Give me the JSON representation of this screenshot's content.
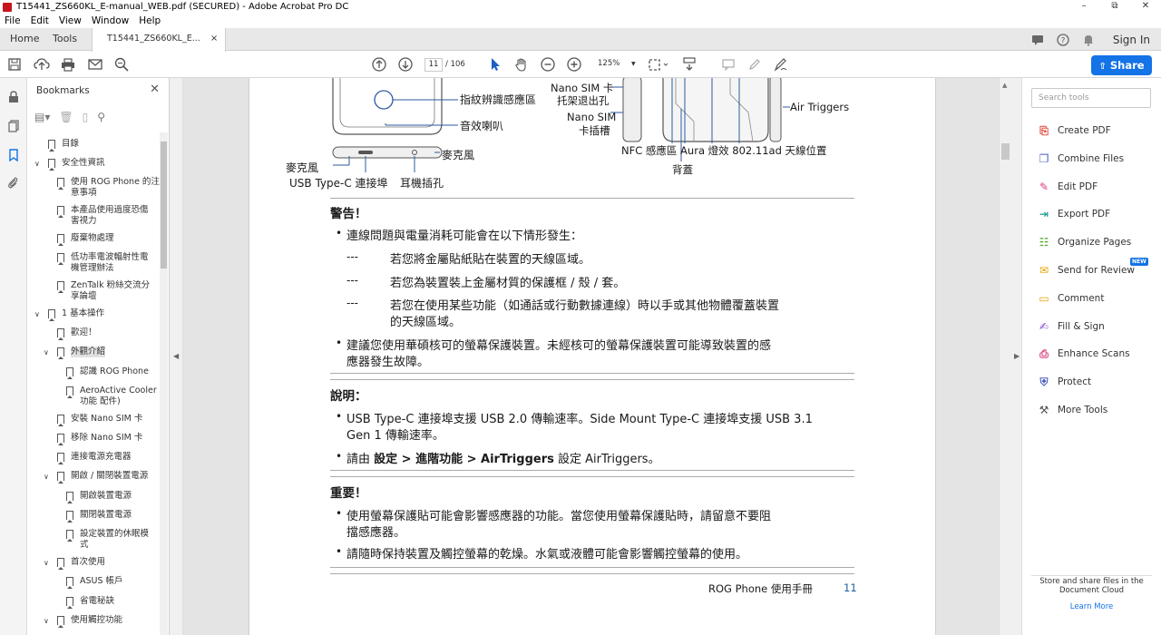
{
  "window": {
    "title": "T15441_ZS660KL_E-manual_WEB.pdf (SECURED) - Adobe Acrobat Pro DC",
    "controls": [
      "–",
      "⧉",
      "✕"
    ]
  },
  "menu": [
    "File",
    "Edit",
    "View",
    "Window",
    "Help"
  ],
  "tabs": {
    "home": "Home",
    "tools": "Tools",
    "doc": "T15441_ZS660KL_E...",
    "close": "×"
  },
  "account": {
    "signin": "Sign In"
  },
  "toolbar": {
    "page_current": "11",
    "page_total": "/ 106",
    "zoom": "125%",
    "share": "Share"
  },
  "bookmarks": {
    "header": "Bookmarks",
    "items": [
      {
        "label": "目錄",
        "level": 0,
        "twisty": ""
      },
      {
        "label": "安全性資訊",
        "level": 0,
        "twisty": "v"
      },
      {
        "label": "使用 ROG Phone 的注",
        "label2": "意事項",
        "level": 1,
        "twisty": ""
      },
      {
        "label": "本產品使用過度恐傷",
        "label2": "害視力",
        "level": 1,
        "twisty": ""
      },
      {
        "label": "廢棄物處理",
        "level": 1,
        "twisty": ""
      },
      {
        "label": "低功率電波輻射性電",
        "label2": "機管理辦法",
        "level": 1,
        "twisty": ""
      },
      {
        "label": "ZenTalk 粉絲交流分",
        "label2": "享論壇",
        "level": 1,
        "twisty": ""
      },
      {
        "label": "1 基本操作",
        "level": 0,
        "twisty": "v"
      },
      {
        "label": "歡迎！",
        "level": 1,
        "twisty": ""
      },
      {
        "label": "外觀介紹",
        "level": 1,
        "twisty": "v",
        "selected": true
      },
      {
        "label": "認識 ROG Phone",
        "level": 2,
        "twisty": ""
      },
      {
        "label": "AeroActive Cooler",
        "label2": "功能  配件)",
        "level": 2,
        "twisty": ""
      },
      {
        "label": "安裝 Nano SIM 卡",
        "level": 1,
        "twisty": ""
      },
      {
        "label": "移除 Nano SIM 卡",
        "level": 1,
        "twisty": ""
      },
      {
        "label": "連接電源充電器",
        "level": 1,
        "twisty": ""
      },
      {
        "label": "開啟 / 關閉裝置電源",
        "level": 1,
        "twisty": "v"
      },
      {
        "label": "開啟裝置電源",
        "level": 2,
        "twisty": ""
      },
      {
        "label": "關閉裝置電源",
        "level": 2,
        "twisty": ""
      },
      {
        "label": "設定裝置的休眠模",
        "label2": "式",
        "level": 2,
        "twisty": ""
      },
      {
        "label": "首次使用",
        "level": 1,
        "twisty": "v"
      },
      {
        "label": "ASUS 帳戶",
        "level": 2,
        "twisty": ""
      },
      {
        "label": "省電秘訣",
        "level": 2,
        "twisty": ""
      },
      {
        "label": "使用觸控功能",
        "level": 1,
        "twisty": "v"
      }
    ]
  },
  "tools_pane": {
    "search_placeholder": "Search tools",
    "items": [
      {
        "label": "Create PDF",
        "icon": "create-pdf-icon",
        "color": "#e0463b"
      },
      {
        "label": "Combine Files",
        "icon": "combine-files-icon",
        "color": "#4b5cc4"
      },
      {
        "label": "Edit PDF",
        "icon": "edit-pdf-icon",
        "color": "#d83a7c"
      },
      {
        "label": "Export PDF",
        "icon": "export-pdf-icon",
        "color": "#27a199"
      },
      {
        "label": "Organize Pages",
        "icon": "organize-pages-icon",
        "color": "#4ea42d"
      },
      {
        "label": "Send for Review",
        "icon": "send-review-icon",
        "color": "#e6a500"
      },
      {
        "label": "Comment",
        "icon": "comment-icon",
        "color": "#e6a500"
      },
      {
        "label": "Fill & Sign",
        "icon": "fill-sign-icon",
        "color": "#8a4fcf"
      },
      {
        "label": "Enhance Scans",
        "icon": "enhance-scans-icon",
        "color": "#d83a7c"
      },
      {
        "label": "Protect",
        "icon": "protect-icon",
        "color": "#4b5cc4"
      },
      {
        "label": "More Tools",
        "icon": "more-tools-icon",
        "color": "#555555"
      }
    ],
    "new_badge": "NEW",
    "footer_line1": "Store and share files in the",
    "footer_line2": "Document Cloud",
    "learn_more": "Learn More"
  },
  "document": {
    "diagram_labels": {
      "fingerprint": "指紋辨識感應區",
      "speaker": "音效喇叭",
      "mic_right": "麥克風",
      "mic_left": "麥克風",
      "usbc": "USB Type-C 連接埠",
      "headphone": "耳機插孔",
      "nano_tray_1": "Nano SIM 卡",
      "nano_tray_2": "托架退出孔",
      "nano_slot_1": "Nano SIM",
      "nano_slot_2": "卡插槽",
      "air_triggers": "Air Triggers",
      "bottom_labels": "NFC 感應區  Aura 燈效  802.11ad 天線位置",
      "back_cover": "背蓋"
    },
    "warning": {
      "title": "警告！",
      "b1": "連線問題與電量消耗可能會在以下情形發生：",
      "d1": "若您將金屬貼紙貼在裝置的天線區域。",
      "d2": "若您為裝置裝上金屬材質的保護框 / 殼 / 套。",
      "d3a": "若您在使用某些功能（如通話或行動數據連線）時以手或其他物體覆蓋裝置",
      "d3b": "的天線區域。",
      "dash": "---",
      "b2a": "建議您使用華碩核可的螢幕保護裝置。未經核可的螢幕保護裝置可能導致裝置的感",
      "b2b": "應器發生故障。"
    },
    "note": {
      "title": "說明：",
      "b1a": "USB Type-C 連接埠支援 USB 2.0 傳輸速率。Side Mount Type-C 連接埠支援 USB 3.1",
      "b1b": "Gen 1 傳輸速率。",
      "b2_pre": "請由 ",
      "b2_bold": "設定 > 進階功能 > AirTriggers",
      "b2_post": " 設定 AirTriggers。"
    },
    "important": {
      "title": "重要！",
      "b1a": "使用螢幕保護貼可能會影響感應器的功能。當您使用螢幕保護貼時，請留意不要阻",
      "b1b": "擋感應器。",
      "b2": "請隨時保持裝置及觸控螢幕的乾燥。水氣或液體可能會影響觸控螢幕的使用。"
    },
    "footer": {
      "manual": "ROG Phone 使用手冊",
      "page": "11"
    }
  }
}
